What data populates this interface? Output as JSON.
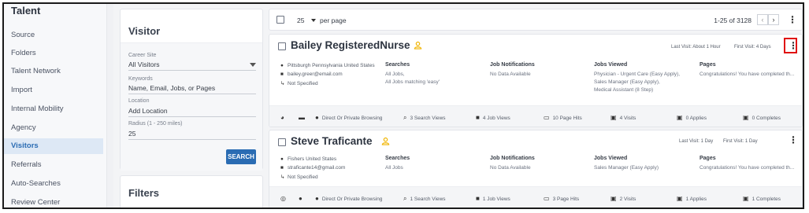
{
  "sidebar": {
    "title": "Talent",
    "items": [
      {
        "label": "Source"
      },
      {
        "label": "Folders"
      },
      {
        "label": "Talent Network"
      },
      {
        "label": "Import"
      },
      {
        "label": "Internal Mobility"
      },
      {
        "label": "Agency"
      },
      {
        "label": "Visitors",
        "active": true
      },
      {
        "label": "Referrals"
      },
      {
        "label": "Auto-Searches"
      },
      {
        "label": "Review Center"
      }
    ]
  },
  "visitor_panel": {
    "title": "Visitor",
    "career_site_label": "Career Site",
    "career_site_value": "All Visitors",
    "keywords_label": "Keywords",
    "keywords_placeholder": "Name, Email, Jobs, or Pages",
    "location_label": "Location",
    "location_placeholder": "Add Location",
    "radius_label": "Radius (1 - 250 miles)",
    "radius_value": "25",
    "search_button": "SEARCH"
  },
  "filters_panel": {
    "title": "Filters"
  },
  "toolbar": {
    "per_page_value": "25",
    "per_page_label": "per page",
    "range": "1-25 of 3128",
    "prev": "‹",
    "next": "›"
  },
  "visitors": [
    {
      "name": "Bailey RegisteredNurse",
      "last_visit": "Last Visit: About 1 Hour",
      "first_visit": "First Visit: 4 Days",
      "location": "Pittsburgh Pennsylvania United States",
      "email": "bailey.greer@email.com",
      "phone": "Not Specified",
      "searches_header": "Searches",
      "searches": [
        "All Jobs,",
        "All Jobs matching 'easy'"
      ],
      "notifications_header": "Job Notifications",
      "notifications": "No Data Available",
      "jobs_viewed_header": "Jobs Viewed",
      "jobs_viewed": [
        "Physician - Urgent Care (Easy Apply),",
        "Sales Manager (Easy Apply),",
        "Medical Assistant (8 Step)"
      ],
      "pages_header": "Pages",
      "pages": "Congratulations! You have completed th...",
      "stats": {
        "browsing": "Direct Or Private Browsing",
        "search_views": "3 Search Views",
        "job_views": "4 Job Views",
        "page_hits": "10 Page Hits",
        "visits": "4 Visits",
        "applies": "0 Applies",
        "completes": "0 Completes"
      }
    },
    {
      "name": "Steve Traficante",
      "last_visit": "Last Visit: 1 Day",
      "first_visit": "First Visit: 1 Day",
      "location": "Fishers United States",
      "email": "straficante14@gmail.com",
      "phone": "Not Specified",
      "searches_header": "Searches",
      "searches": [
        "All Jobs"
      ],
      "notifications_header": "Job Notifications",
      "notifications": "No Data Available",
      "jobs_viewed_header": "Jobs Viewed",
      "jobs_viewed": [
        "Sales Manager (Easy Apply)"
      ],
      "pages_header": "Pages",
      "pages": "Congratulations! You have completed th...",
      "stats": {
        "browsing": "Direct Or Private Browsing",
        "search_views": "1 Search Views",
        "job_views": "1 Job Views",
        "page_hits": "3 Page Hits",
        "visits": "2 Visits",
        "applies": "1 Applies",
        "completes": "1 Completes"
      }
    }
  ],
  "icons": {
    "location": "location-pin-icon",
    "email": "email-icon",
    "phone": "phone-icon",
    "more": "kebab-menu-icon",
    "person": "person-icon"
  },
  "colors": {
    "accent": "#2a6cb3",
    "highlight": "#e01010",
    "person_icon": "#f0b400"
  }
}
